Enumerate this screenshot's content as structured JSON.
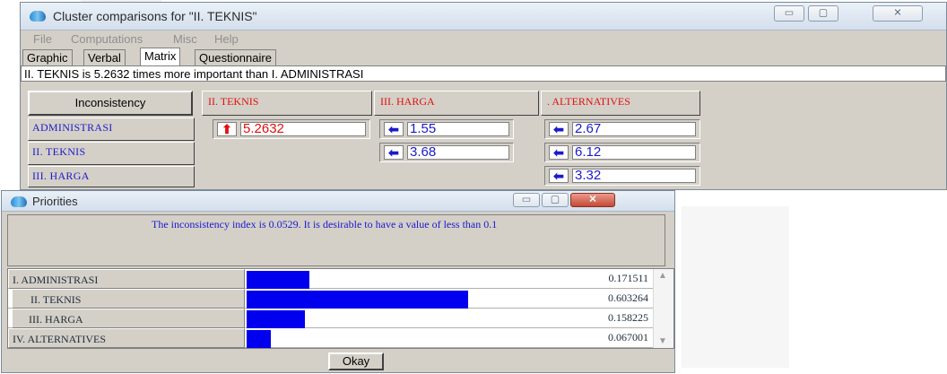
{
  "main_window": {
    "title": "Cluster comparisons for \"II. TEKNIS\"",
    "controls": {
      "minimize": "▭",
      "maximize": "▢",
      "close": "✕"
    },
    "menu": [
      "File",
      "Computations",
      "Misc",
      "Help"
    ],
    "tabs": [
      "Graphic",
      "Verbal",
      "Matrix",
      "Questionnaire"
    ],
    "active_tab": "Matrix",
    "status": "II. TEKNIS is 5.2632 times more important than  I. ADMINISTRASI",
    "inconsistency_button": "Inconsistency",
    "columns": [
      "II. TEKNIS",
      "III. HARGA",
      ". ALTERNATIVES"
    ],
    "rows": [
      "ADMINISTRASI",
      "II. TEKNIS",
      "III. HARGA"
    ],
    "cells": [
      {
        "arrow": "up",
        "value": "5.2632"
      },
      {
        "arrow": "left",
        "value": "1.55"
      },
      {
        "arrow": "left",
        "value": "2.67"
      },
      {
        "arrow": "left",
        "value": "3.68"
      },
      {
        "arrow": "left",
        "value": "6.12"
      },
      {
        "arrow": "left",
        "value": "3.32"
      }
    ],
    "colors": {
      "red": "#e01010",
      "blue": "#1a1acc"
    }
  },
  "priorities_window": {
    "title": "Priorities",
    "message": "The inconsistency index is 0.0529.  It is desirable to have a value of less than 0.1",
    "items": [
      {
        "label": "I. ADMINISTRASI",
        "value": "0.171511",
        "fraction": 0.171511
      },
      {
        "label": "II. TEKNIS",
        "value": "0.603264",
        "fraction": 0.603264
      },
      {
        "label": "III. HARGA",
        "value": "0.158225",
        "fraction": 0.158225
      },
      {
        "label": "IV. ALTERNATIVES",
        "value": "0.067001",
        "fraction": 0.067001
      }
    ],
    "bar_color": "#0000ee",
    "okay_label": "Okay"
  }
}
